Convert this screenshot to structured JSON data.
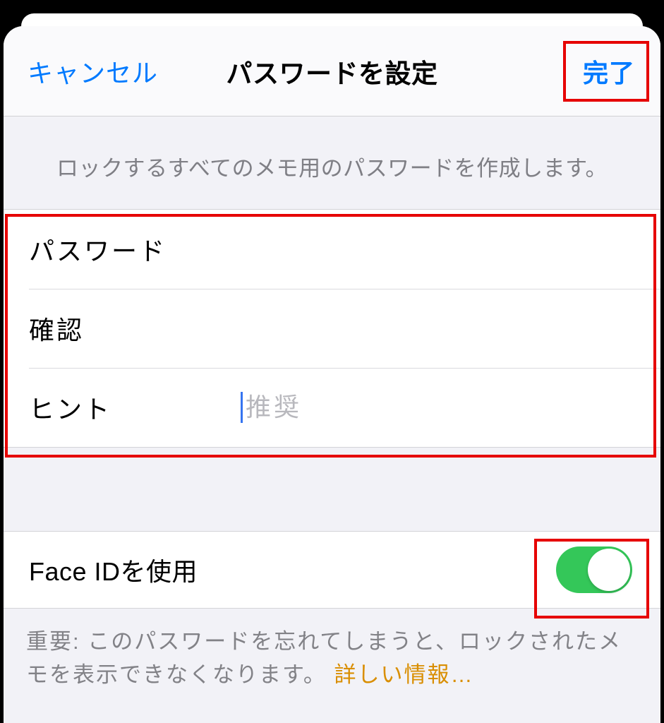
{
  "navbar": {
    "cancel": "キャンセル",
    "title": "パスワードを設定",
    "done": "完了"
  },
  "description": "ロックするすべてのメモ用のパスワードを作成します。",
  "form": {
    "password_label": "パスワード",
    "verify_label": "確認",
    "hint_label": "ヒント",
    "hint_placeholder": "推奨"
  },
  "faceid": {
    "label": "Face IDを使用",
    "enabled": true
  },
  "footer": {
    "text": "重要: このパスワードを忘れてしまうと、ロックされたメモを表示できなくなります。 ",
    "link": "詳しい情報…"
  }
}
